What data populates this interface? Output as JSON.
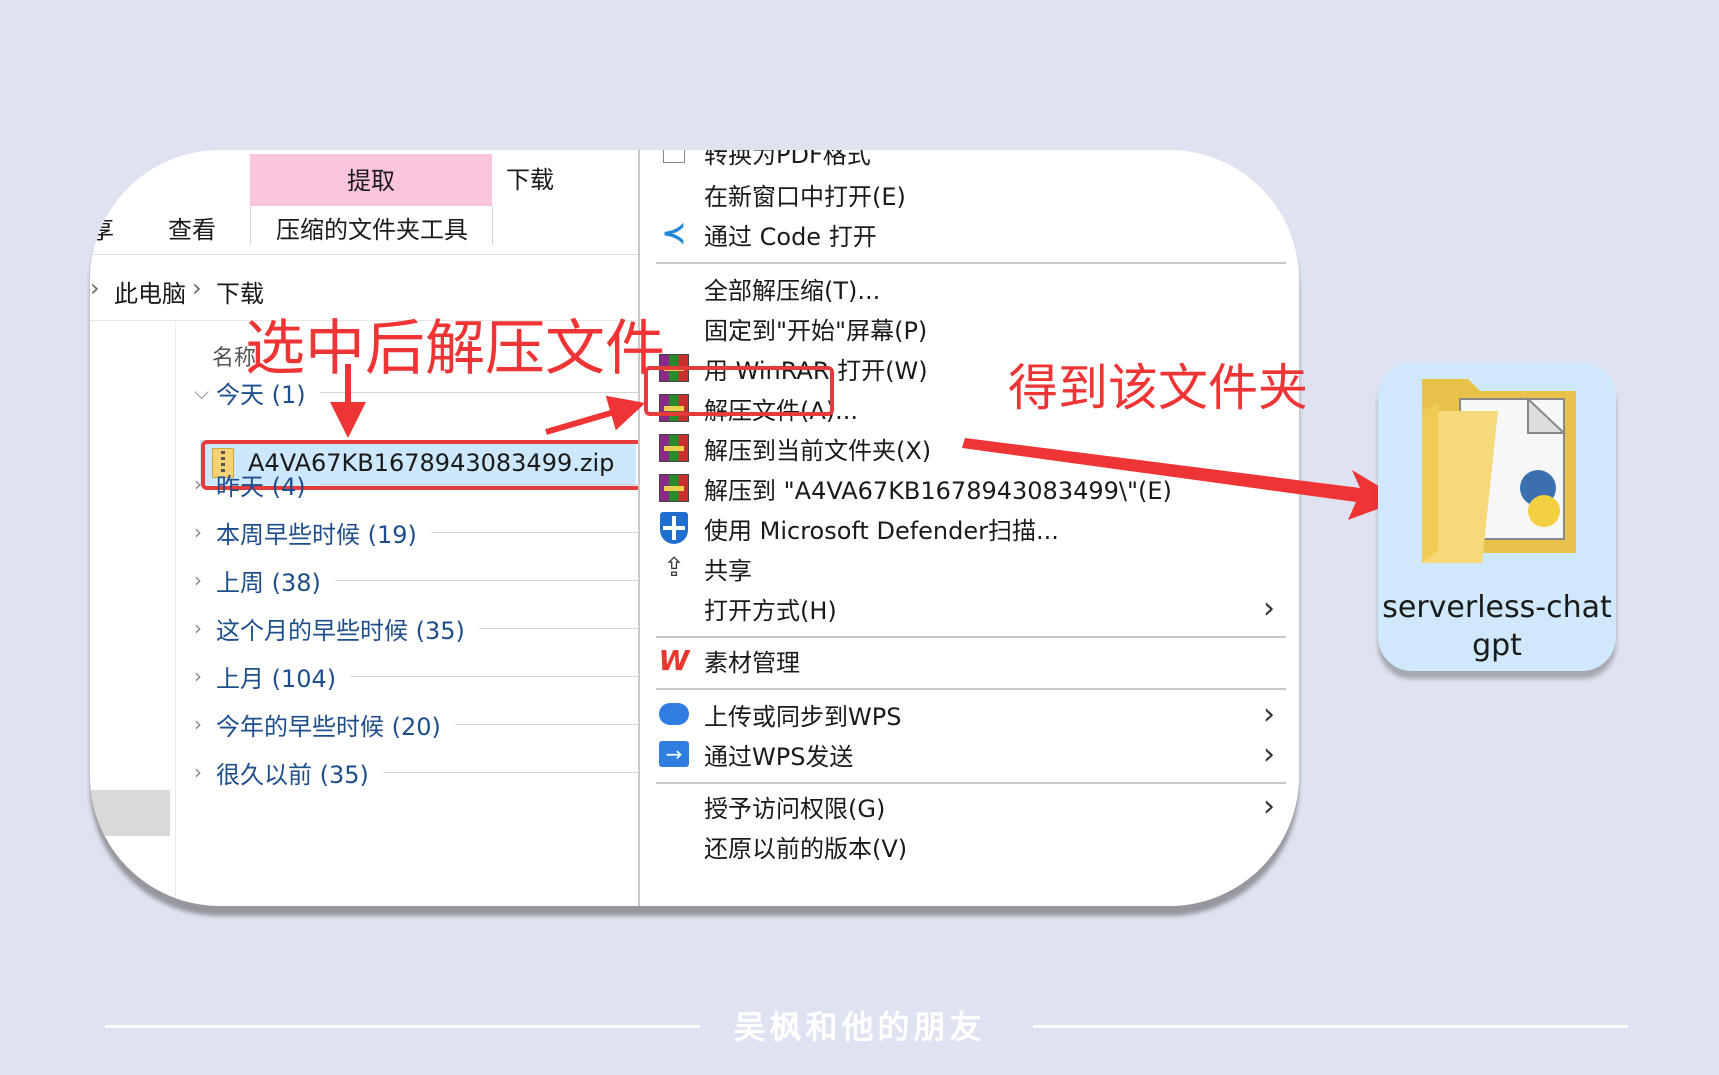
{
  "explorer": {
    "ribbon": {
      "extract_tab": "提取",
      "download_tab": "下载",
      "share_tab_partial": "享",
      "view_tab": "查看",
      "compressed_tools": "压缩的文件夹工具"
    },
    "breadcrumb": [
      "此电脑",
      "下载"
    ],
    "column_header": "名称",
    "groups": [
      {
        "label": "今天 (1)",
        "expanded": true
      },
      {
        "label": "昨天 (4)",
        "expanded": false
      },
      {
        "label": "本周早些时候 (19)",
        "expanded": false
      },
      {
        "label": "上周 (38)",
        "expanded": false
      },
      {
        "label": "这个月的早些时候 (35)",
        "expanded": false
      },
      {
        "label": "上月 (104)",
        "expanded": false
      },
      {
        "label": "今年的早些时候 (20)",
        "expanded": false
      },
      {
        "label": "很久以前 (35)",
        "expanded": false
      }
    ],
    "selected_file": "A4VA67KB1678943083499.zip"
  },
  "context_menu": {
    "partial_top_item": "转换为PDF格式",
    "items": [
      {
        "label": "在新窗口中打开(E)",
        "icon": "none"
      },
      {
        "label": "通过 Code 打开",
        "icon": "vscode-icon"
      },
      {
        "label": "全部解压缩(T)...",
        "icon": "none"
      },
      {
        "label": "固定到\"开始\"屏幕(P)",
        "icon": "none"
      },
      {
        "label": "用 WinRAR 打开(W)",
        "icon": "winrar-icon"
      },
      {
        "label": "解压文件(A)...",
        "icon": "winrar-icon"
      },
      {
        "label": "解压到当前文件夹(X)",
        "icon": "winrar-icon"
      },
      {
        "label": "解压到 \"A4VA67KB1678943083499\\\"(E)",
        "icon": "winrar-icon"
      },
      {
        "label": "使用 Microsoft Defender扫描...",
        "icon": "defender-icon"
      },
      {
        "label": "共享",
        "icon": "share-icon"
      },
      {
        "label": "打开方式(H)",
        "icon": "none"
      },
      {
        "label": "素材管理",
        "icon": "wps-icon"
      },
      {
        "label": "上传或同步到WPS",
        "icon": "cloud-upload-icon"
      },
      {
        "label": "通过WPS发送",
        "icon": "send-icon"
      },
      {
        "label": "授予访问权限(G)",
        "icon": "none"
      },
      {
        "label": "还原以前的版本(V)",
        "icon": "none"
      }
    ]
  },
  "annotations": {
    "left": "选中后解压文件",
    "right": "得到该文件夹"
  },
  "result_folder": {
    "name_line1": "serverless-chat",
    "name_line2": "gpt"
  },
  "footer": {
    "watermark": "吴枫和他的朋友"
  },
  "colors": {
    "background": "#dfe3f1",
    "annotation_red": "#ee3434",
    "selection_blue": "#cce8ff",
    "ribbon_pink": "#fbc4dd",
    "group_text": "#1e4e8c"
  }
}
